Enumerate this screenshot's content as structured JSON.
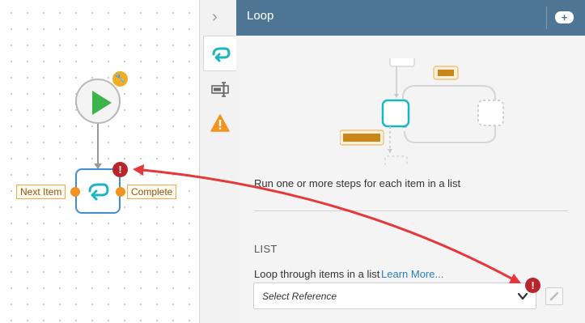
{
  "canvas": {
    "start_node": {
      "icon": "play-icon",
      "badge_icon": "wrench-icon",
      "badge_glyph": "🔧"
    },
    "loop_node": {
      "icon": "loop-icon",
      "error_badge": "!",
      "left_port_label": "Next Item",
      "right_port_label": "Complete"
    }
  },
  "rail": {
    "collapse_glyph": "›",
    "tabs": [
      {
        "icon": "loop-icon"
      },
      {
        "icon": "text-cursor-icon"
      },
      {
        "icon": "warning-icon"
      }
    ]
  },
  "panel": {
    "title": "Loop",
    "header_button": "+",
    "description": "Run one or more steps for each item in a list",
    "section_title": "LIST",
    "field_label": "Loop through items in a list",
    "learn_more": "Learn More...",
    "select": {
      "value": "Select Reference",
      "error_badge": "!"
    }
  },
  "colors": {
    "header": "#4e7694",
    "error": "#b9252a",
    "port": "#f2931e",
    "loop_blue": "#3f8fd6",
    "teal": "#1cb5c1",
    "annotation_arrow": "#e5383b"
  }
}
